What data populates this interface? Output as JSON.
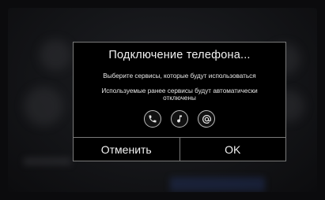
{
  "dialog": {
    "title": "Подключение телефона...",
    "message_select": "Выберите сервисы, которые будут использоваться",
    "message_disconnect": "Используемые ранее сервисы будут автоматически отключены",
    "services": [
      {
        "icon": "phone-icon"
      },
      {
        "icon": "music-note-icon"
      },
      {
        "icon": "at-sign-icon"
      }
    ],
    "cancel_label": "Отменить",
    "ok_label": "OK"
  },
  "colors": {
    "dialog_background": "#000000",
    "dialog_border": "#7a7a7a",
    "text": "#f2f2f2",
    "icon_ring": "#bdbdbd"
  }
}
